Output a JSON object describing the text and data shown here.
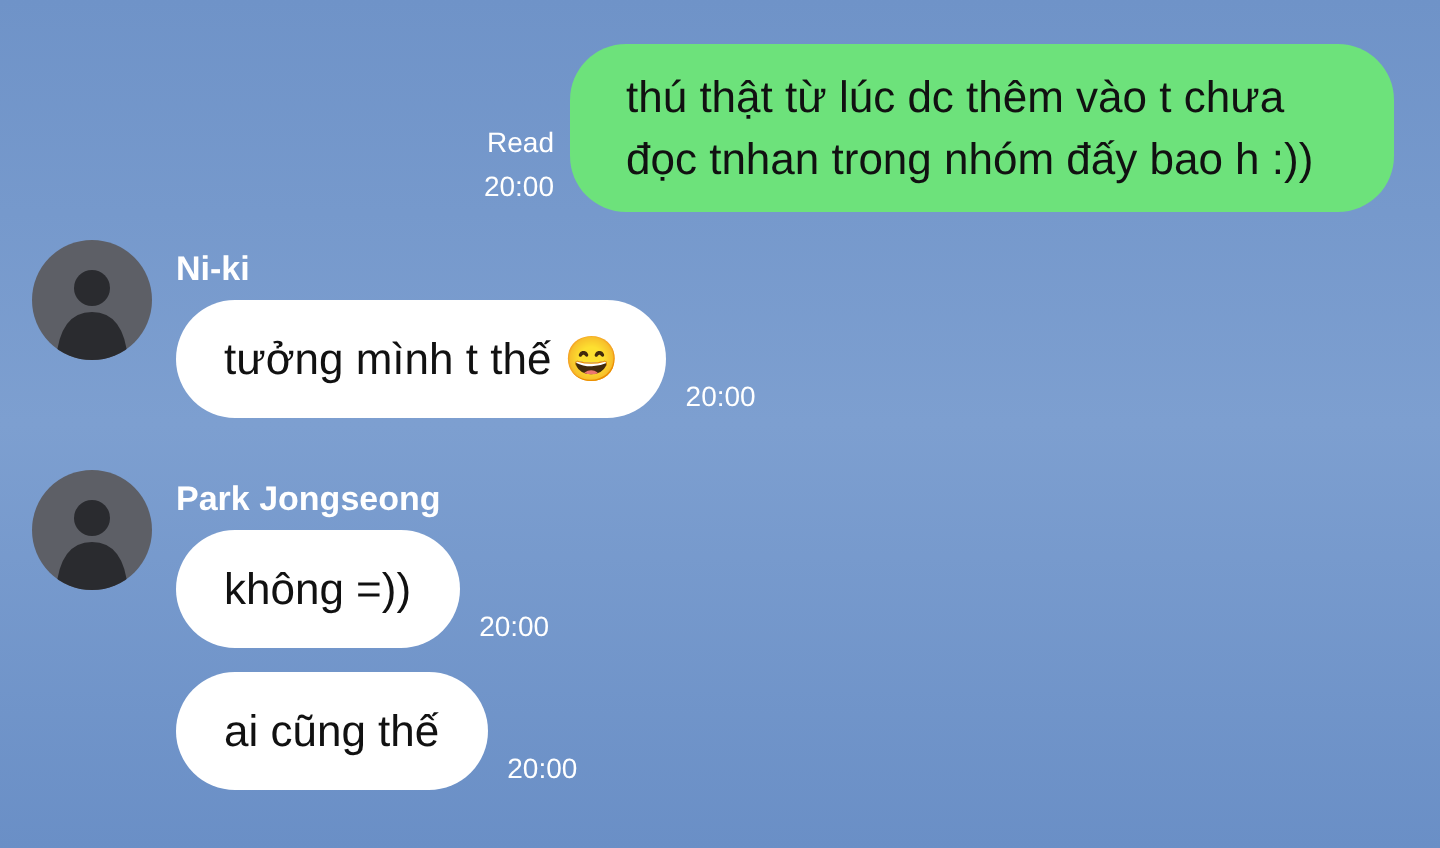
{
  "sent": {
    "text": "thú thật từ lúc dc thêm vào t chưa đọc tnhan trong nhóm đấy bao h :))",
    "read_label": "Read",
    "time": "20:00"
  },
  "groups": [
    {
      "sender": "Ni-ki",
      "messages": [
        {
          "text": "tưởng mình t thế 😄",
          "time": "20:00"
        }
      ]
    },
    {
      "sender": "Park Jongseong",
      "messages": [
        {
          "text": "không =))",
          "time": "20:00"
        },
        {
          "text": "ai cũng thế",
          "time": "20:00"
        }
      ]
    }
  ]
}
